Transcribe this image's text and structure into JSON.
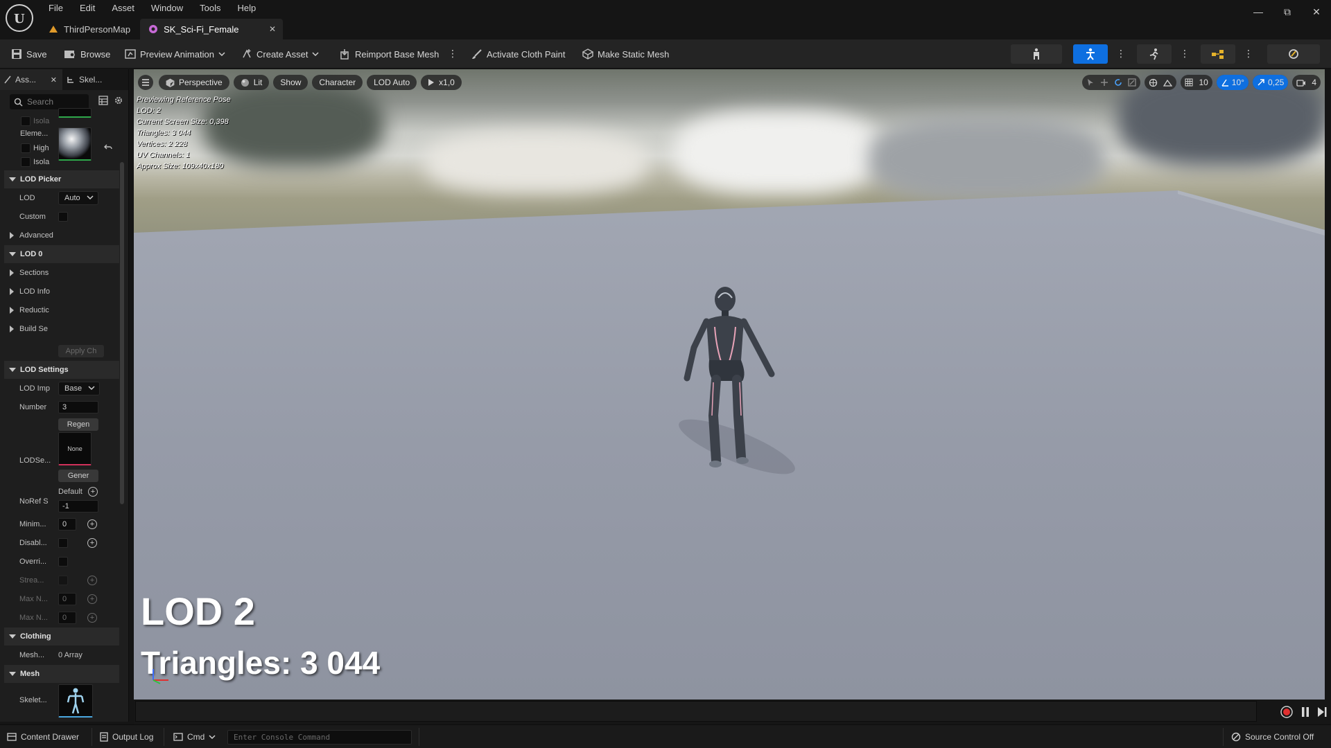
{
  "app": {
    "menu": [
      "File",
      "Edit",
      "Asset",
      "Window",
      "Tools",
      "Help"
    ],
    "tabs": [
      {
        "label": "ThirdPersonMap"
      },
      {
        "label": "SK_Sci-Fi_Female"
      }
    ]
  },
  "toolbar": {
    "save": "Save",
    "browse": "Browse",
    "preview_animation": "Preview Animation",
    "create_asset": "Create Asset",
    "reimport": "Reimport Base Mesh",
    "cloth_paint": "Activate Cloth Paint",
    "static_mesh": "Make Static Mesh"
  },
  "details": {
    "tabs": [
      "Ass...",
      "Skel..."
    ],
    "search_placeholder": "Search",
    "rows": {
      "isola1": "Isola",
      "element": "Eleme...",
      "high": "High",
      "isola2": "Isola",
      "lod_picker": "LOD Picker",
      "lod": "LOD",
      "lod_value": "Auto",
      "custom": "Custom",
      "advanced": "Advanced",
      "lod0": "LOD 0",
      "sections": "Sections",
      "lod_info": "LOD Info",
      "reduction": "Reductic",
      "build_settings": "Build Se",
      "apply_changes": "Apply Ch",
      "lod_settings": "LOD Settings",
      "lod_import": "LOD Imp",
      "lod_import_value": "Base",
      "number": "Number",
      "number_value": "3",
      "regen": "Regen",
      "lodsettings": "LODSe...",
      "none": "None",
      "generate": "Gener",
      "noref": "NoRef S",
      "default": "Default",
      "noref_value": "-1",
      "minimum": "Minim...",
      "minimum_value": "0",
      "disable": "Disabl...",
      "override": "Overri...",
      "stream": "Strea...",
      "maxn1": "Max N...",
      "maxn1_value": "0",
      "maxn2": "Max N...",
      "maxn2_value": "0",
      "clothing": "Clothing",
      "mesh_label": "Mesh...",
      "mesh_value": "0 Array",
      "mesh_section": "Mesh",
      "skeleton": "Skelet..."
    }
  },
  "viewport": {
    "perspective": "Perspective",
    "lit": "Lit",
    "show": "Show",
    "character": "Character",
    "lod_auto": "LOD Auto",
    "speed": "x1,0",
    "grid_snap": "10",
    "rot_snap": "10°",
    "scale_snap": "0,25",
    "cam_speed": "4",
    "info": [
      "Previewing Reference Pose",
      "LOD: 2",
      "Current Screen Size: 0,398",
      "Triangles: 3 044",
      "Vertices: 2 228",
      "UV Channels: 1",
      "Approx Size: 109x40x180"
    ],
    "big_lod": "LOD 2",
    "big_triangles": "Triangles: 3 044"
  },
  "statusbar": {
    "content_drawer": "Content Drawer",
    "output_log": "Output Log",
    "cmd": "Cmd",
    "console_placeholder": "Enter Console Command",
    "source_control": "Source Control Off"
  },
  "colors": {
    "accent": "#0e6fe0",
    "record": "#e03030"
  }
}
